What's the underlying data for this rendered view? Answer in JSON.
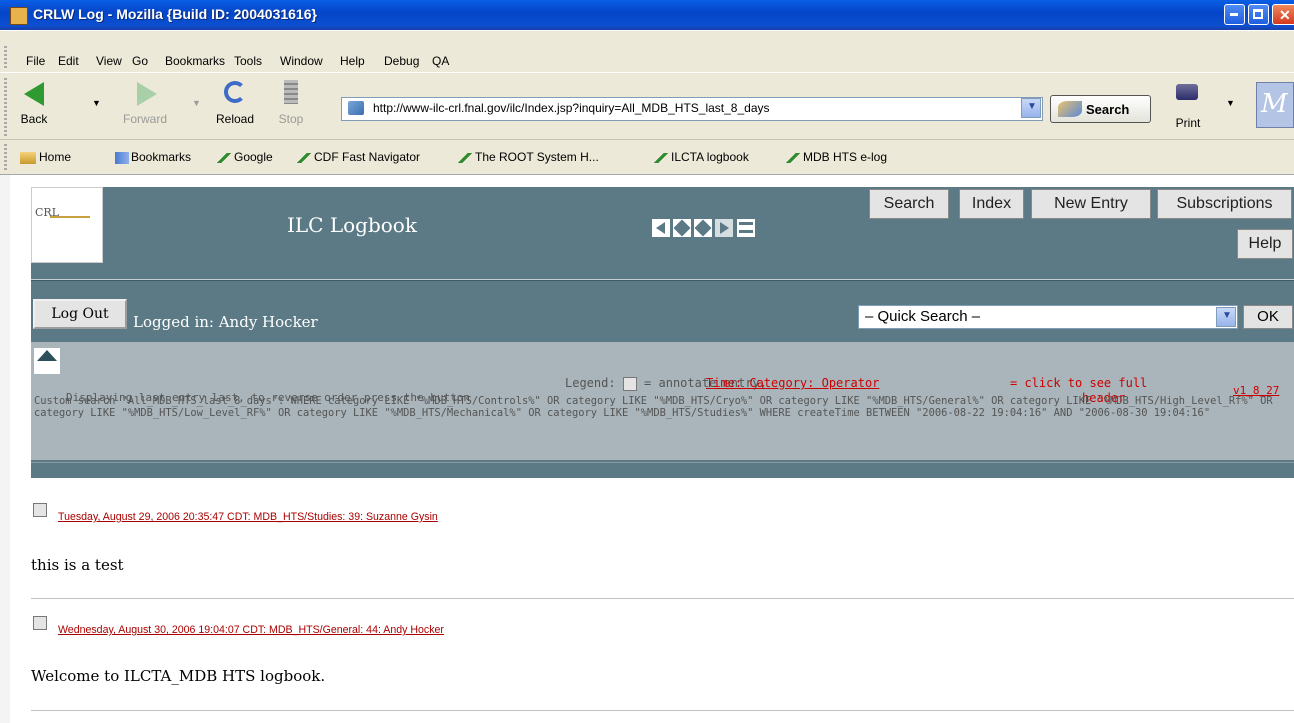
{
  "window": {
    "title": "CRLW Log - Mozilla {Build ID: 2004031616}"
  },
  "menu": [
    "File",
    "Edit",
    "View",
    "Go",
    "Bookmarks",
    "Tools",
    "Window",
    "Help",
    "Debug",
    "QA"
  ],
  "toolbar": {
    "back_label": "Back",
    "forward_label": "Forward",
    "reload_label": "Reload",
    "stop_label": "Stop",
    "search_label": "Search",
    "print_label": "Print"
  },
  "address": {
    "url": "http://www-ilc-crl.fnal.gov/ilc/Index.jsp?inquiry=All_MDB_HTS_last_8_days"
  },
  "personal_toolbar": [
    "Home",
    "Bookmarks",
    "Google",
    "CDF Fast Navigator",
    "The ROOT System H...",
    "ILCTA logbook",
    "MDB HTS e-log"
  ],
  "page": {
    "logo_text": "CRL",
    "title": "ILC Logbook",
    "buttons": {
      "search": "Search",
      "index": "Index",
      "new_entry": "New Entry",
      "subscriptions": "Subscriptions",
      "help": "Help"
    },
    "logout_label": "Log Out",
    "logged_in": "Logged in: Andy Hocker",
    "quick_search": "– Quick Search –",
    "ok_label": "OK",
    "display_note": "Displaying last entry last, to reverse order press the button",
    "legend_prefix": "Legend:",
    "legend_annotate": "= annotate entry,",
    "legend_link": "Time: Category: Operator",
    "legend_suffix": "= click to see full",
    "legend_header": "header",
    "version": "v1_8_27",
    "custom_search": "Custom search \"All_MDB_HTS_last_8_days\": WHERE category LIKE \"%MDB_HTS/Controls%\" OR category LIKE \"%MDB_HTS/Cryo%\" OR category LIKE \"%MDB_HTS/General%\" OR category LIKE \"%MDB_HTS/High_Level_Rf%\" OR category LIKE \"%MDB_HTS/Low_Level_RF%\" OR category LIKE \"%MDB_HTS/Mechanical%\" OR category LIKE \"%MDB_HTS/Studies%\" WHERE createTime BETWEEN \"2006-08-22 19:04:16\" AND \"2006-08-30 19:04:16\""
  },
  "entries": [
    {
      "header": "Tuesday, August 29, 2006 20:35:47 CDT: MDB_HTS/Studies: 39: Suzanne Gysin",
      "body": "this is a test"
    },
    {
      "header": "Wednesday, August 30, 2006 19:04:07 CDT: MDB_HTS/General: 44: Andy Hocker",
      "body": "Welcome to ILCTA_MDB HTS logbook."
    }
  ]
}
